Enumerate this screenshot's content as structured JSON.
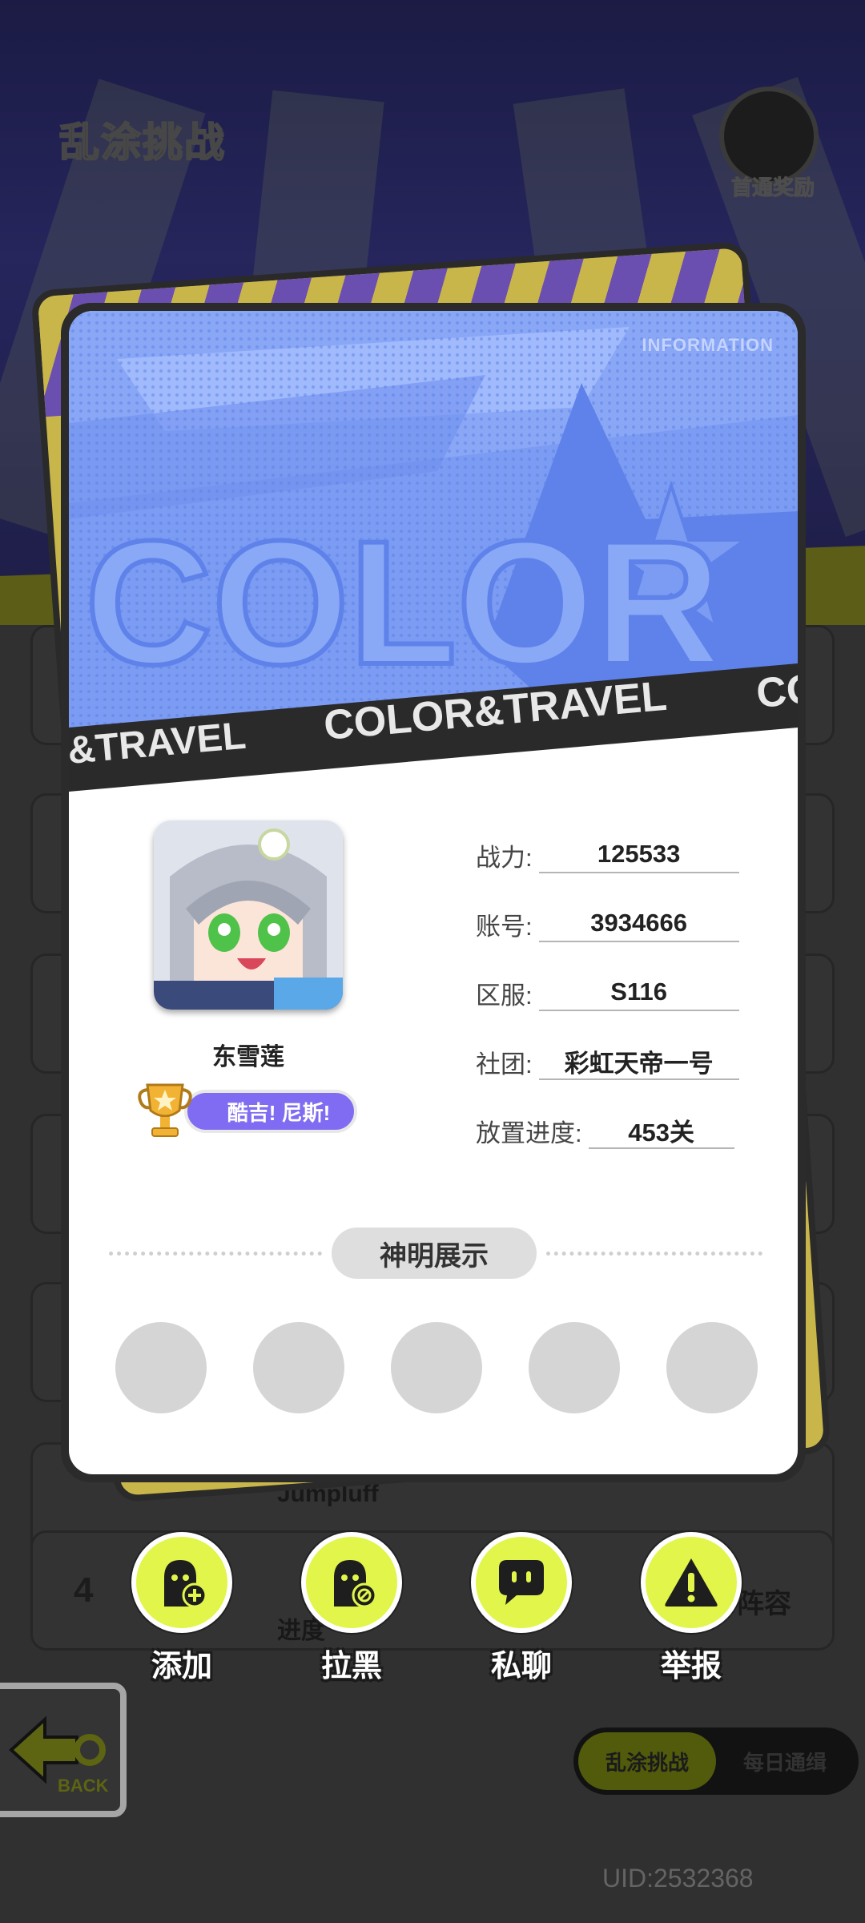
{
  "background": {
    "title": "乱涂挑战",
    "reward_label": "首通奖励",
    "rows": [
      {
        "rank": "4",
        "name": "Jumpluff",
        "lineup_label": "阵容",
        "progress_prefix": "进度"
      }
    ],
    "tabs": [
      {
        "label": "乱涂挑战",
        "active": true
      },
      {
        "label": "每日通缉",
        "active": false
      }
    ],
    "uid": "UID:2532368",
    "back_label": "BACK"
  },
  "card": {
    "info_tag": "INFORMATION",
    "banner_word": "COLOR",
    "banner_tagline": "COLOR&TRAVEL",
    "banner_tagline_left": "&TRAVEL",
    "banner_tagline_right": "CO",
    "player_name": "东雪莲",
    "title_badge": "酷吉! 尼斯!",
    "stats": [
      {
        "label": "战力:",
        "value": "125533"
      },
      {
        "label": "账号:",
        "value": "3934666"
      },
      {
        "label": "区服:",
        "value": "S116"
      },
      {
        "label": "社团:",
        "value": "彩虹天帝一号"
      },
      {
        "label": "放置进度:",
        "value": "453关"
      }
    ],
    "showcase_title": "神明展示"
  },
  "actions": [
    {
      "label": "添加",
      "icon": "add-friend-icon"
    },
    {
      "label": "拉黑",
      "icon": "block-icon"
    },
    {
      "label": "私聊",
      "icon": "chat-icon"
    },
    {
      "label": "举报",
      "icon": "warning-icon"
    }
  ],
  "colors": {
    "accent_yellow": "#e2f54a",
    "banner_blue": "#6e8ff0",
    "title_purple": "#7f6cf2"
  }
}
